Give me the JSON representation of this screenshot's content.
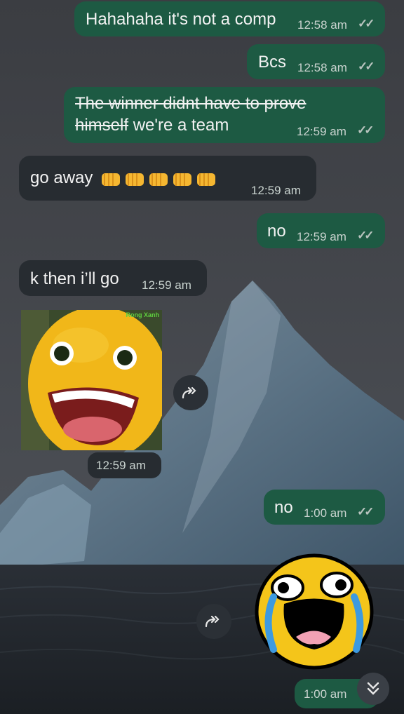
{
  "messages": [
    {
      "id": "m1",
      "side": "out",
      "text": "Hahahaha it's not a comp",
      "time": "12:58 am"
    },
    {
      "id": "m2",
      "side": "out",
      "text": "Bcs",
      "time": "12:58 am"
    },
    {
      "id": "m3",
      "side": "out",
      "strike_line1": "The winner didnt have to prove",
      "strike_line2": "himself",
      "text_after": " we're a team",
      "time": "12:59 am"
    },
    {
      "id": "m4",
      "side": "in",
      "text": "go away",
      "emoji": "fist-emoji x5",
      "time": "12:59 am"
    },
    {
      "id": "m5",
      "side": "out",
      "text": "no",
      "time": "12:59 am"
    },
    {
      "id": "m6",
      "side": "in",
      "text": "k then i’ll go",
      "time": "12:59 am"
    },
    {
      "id": "m7",
      "side": "in",
      "type": "sticker",
      "watermark": "Rong Xanh",
      "time": "12:59 am"
    },
    {
      "id": "m8",
      "side": "out",
      "text": "no",
      "time": "1:00 am"
    },
    {
      "id": "m9",
      "side": "out",
      "type": "sticker",
      "time": "1:00 am"
    }
  ],
  "icons": {
    "read": "double-check-icon",
    "forward": "forward-icon",
    "scroll": "chevron-double-down-icon"
  },
  "colors": {
    "outgoing": "#1d5a43",
    "incoming": "#272c31"
  }
}
